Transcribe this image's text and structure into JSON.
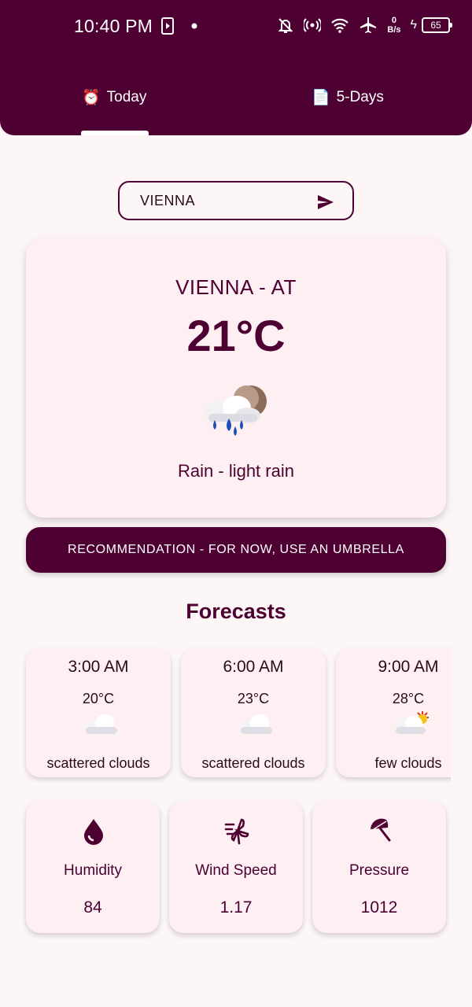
{
  "status_bar": {
    "time": "10:40 PM",
    "net_speed_value": "0",
    "net_speed_unit": "B/s",
    "battery": "65"
  },
  "tabs": [
    {
      "emoji": "⏰",
      "label": "Today",
      "selected": true
    },
    {
      "emoji": "📄",
      "label": "5-Days",
      "selected": false
    }
  ],
  "search": {
    "value": "VIENNA"
  },
  "current": {
    "location": "VIENNA - AT",
    "temperature": "21°C",
    "description": "Rain - light rain",
    "icon": "rain-cloud-moon-icon"
  },
  "recommendation": "RECOMMENDATION - FOR NOW, USE AN UMBRELLA",
  "forecasts_title": "Forecasts",
  "forecasts": [
    {
      "time": "3:00 AM",
      "temp": "20°C",
      "desc": "scattered clouds",
      "icon": "cloud-icon"
    },
    {
      "time": "6:00 AM",
      "temp": "23°C",
      "desc": "scattered clouds",
      "icon": "cloud-icon"
    },
    {
      "time": "9:00 AM",
      "temp": "28°C",
      "desc": "few clouds",
      "icon": "sun-cloud-icon"
    }
  ],
  "stats": [
    {
      "label": "Humidity",
      "value": "84",
      "icon": "water-drop-icon"
    },
    {
      "label": "Wind Speed",
      "value": "1.17",
      "icon": "wind-icon"
    },
    {
      "label": "Pressure",
      "value": "1012",
      "icon": "umbrella-icon"
    }
  ],
  "colors": {
    "primary": "#4e0032",
    "background": "#fdf6f7",
    "card": "#fdeff2"
  }
}
